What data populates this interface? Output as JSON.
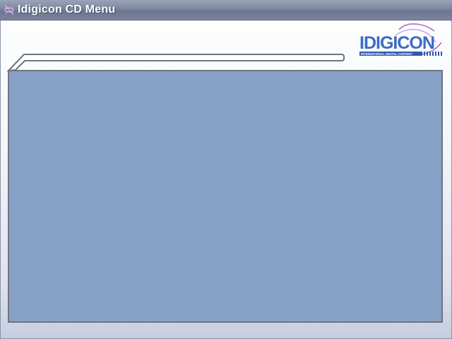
{
  "window": {
    "title": "Idigicon CD Menu",
    "app_icon": "idigicon-swirl-icon"
  },
  "logo": {
    "wordmark": "IDIGICON",
    "tagline": "INTERNATIONAL DIGITAL CONTENT"
  },
  "colors": {
    "panel_fill": "#87a0c5",
    "panel_border": "#6f7480",
    "titlebar": "#7d879d",
    "logo_blue": "#3c6cc4",
    "logo_purple": "#a15fc0"
  }
}
